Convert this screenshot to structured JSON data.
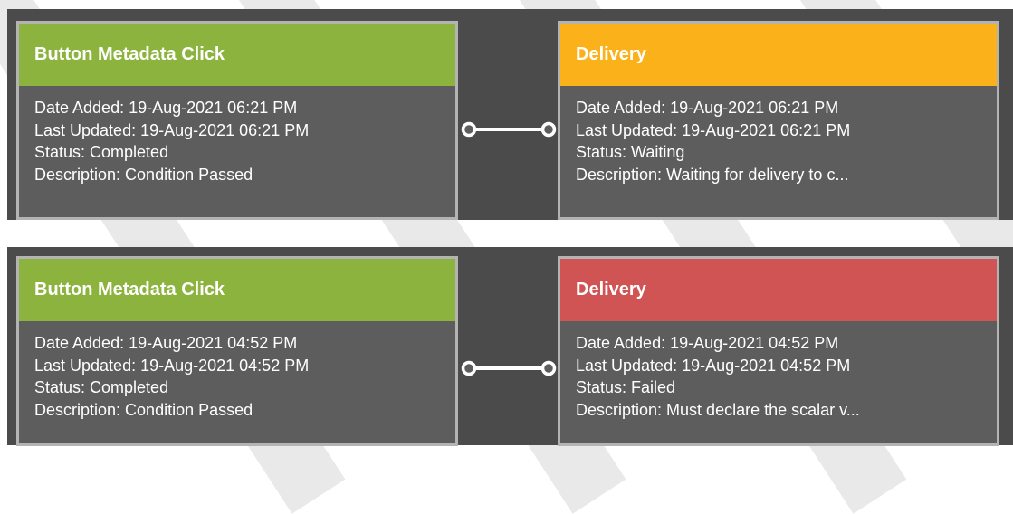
{
  "colors": {
    "background": "#ffffff",
    "panel": "#4b4b4b",
    "card": "#5d5d5d",
    "card_border": "#b3b3b3",
    "completed": "#8db33f",
    "waiting": "#fbb21a",
    "failed": "#d05454",
    "text": "#ffffff"
  },
  "labels": {
    "date_added": "Date Added:",
    "last_updated": "Last Updated:",
    "status": "Status:",
    "description": "Description:"
  },
  "flows": [
    {
      "source": {
        "title": "Button Metadata Click",
        "header_color": "#8db33f",
        "date_added": "19-Aug-2021 06:21 PM",
        "last_updated": "19-Aug-2021 06:21 PM",
        "status": "Completed",
        "description": "Condition Passed"
      },
      "target": {
        "title": "Delivery",
        "header_color": "#fbb21a",
        "date_added": "19-Aug-2021 06:21 PM",
        "last_updated": "19-Aug-2021 06:21 PM",
        "status": "Waiting",
        "description": "Waiting for delivery to c..."
      }
    },
    {
      "source": {
        "title": "Button Metadata Click",
        "header_color": "#8db33f",
        "date_added": "19-Aug-2021 04:52 PM",
        "last_updated": "19-Aug-2021 04:52 PM",
        "status": "Completed",
        "description": "Condition Passed"
      },
      "target": {
        "title": "Delivery",
        "header_color": "#d05454",
        "date_added": "19-Aug-2021 04:52 PM",
        "last_updated": "19-Aug-2021 04:52 PM",
        "status": "Failed",
        "description": "Must declare the scalar v..."
      }
    }
  ]
}
